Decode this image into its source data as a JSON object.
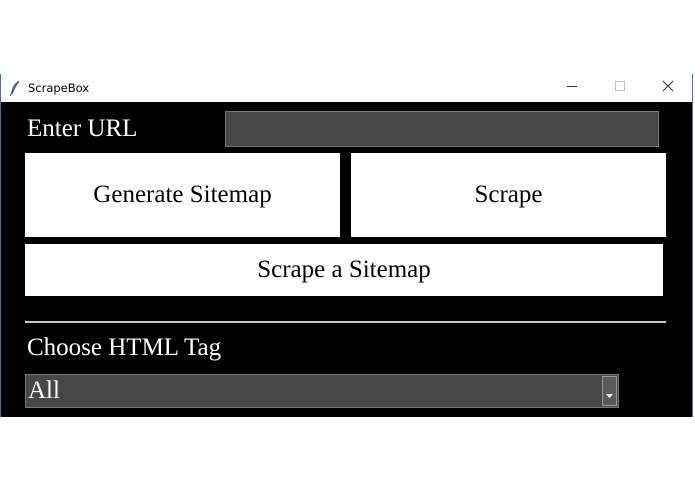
{
  "window": {
    "title": "ScrapeBox"
  },
  "form": {
    "url_label": "Enter URL",
    "url_value": "",
    "url_placeholder": "",
    "generate_sitemap_label": "Generate Sitemap",
    "scrape_label": "Scrape",
    "scrape_sitemap_label": "Scrape a Sitemap",
    "tag_label": "Choose HTML Tag",
    "tag_selected": "All"
  },
  "icons": {
    "app": "feather-icon",
    "minimize": "minimize-icon",
    "maximize": "maximize-icon",
    "close": "close-icon",
    "dropdown": "chevron-down-icon"
  },
  "colors": {
    "background": "#000000",
    "button": "#ffffff",
    "field": "#474747",
    "text": "#ffffff"
  }
}
